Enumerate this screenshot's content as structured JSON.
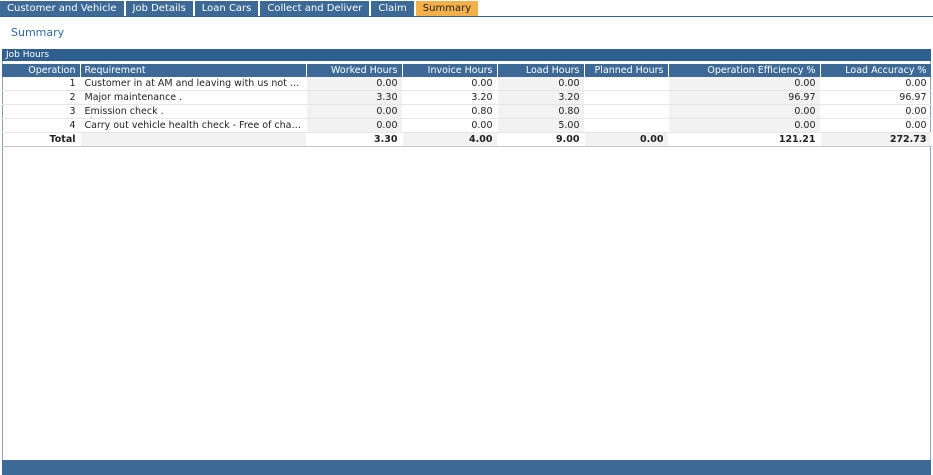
{
  "tabs": [
    {
      "label": "Customer and Vehicle"
    },
    {
      "label": "Job Details"
    },
    {
      "label": "Loan Cars"
    },
    {
      "label": "Collect and Deliver"
    },
    {
      "label": "Claim"
    },
    {
      "label": "Summary"
    }
  ],
  "active_tab": "Summary",
  "page_title": "Summary",
  "panel": {
    "title": "Job Hours"
  },
  "table": {
    "headers": [
      "Operation",
      "Requirement",
      "Worked Hours",
      "Invoice Hours",
      "Load Hours",
      "Planned Hours",
      "Operation Efficiency %",
      "Load Accuracy %"
    ],
    "rows": [
      [
        "1",
        "Customer in at AM and leaving with us not requir...",
        "0.00",
        "0.00",
        "0.00",
        "",
        "0.00",
        "0.00"
      ],
      [
        "2",
        "Major maintenance .",
        "3.30",
        "3.20",
        "3.20",
        "",
        "96.97",
        "96.97"
      ],
      [
        "3",
        "Emission check .",
        "0.00",
        "0.80",
        "0.80",
        "",
        "0.00",
        "0.00"
      ],
      [
        "4",
        "Carry out vehicle health check - Free of charge",
        "0.00",
        "0.00",
        "5.00",
        "",
        "0.00",
        "0.00"
      ]
    ],
    "total": [
      "Total",
      "",
      "3.30",
      "4.00",
      "9.00",
      "0.00",
      "121.21",
      "272.73"
    ]
  },
  "colors": {
    "tab_bg": "#3c6995",
    "tab_active_bg": "#f4b14a",
    "header_bg": "#2f5f8e",
    "title_color": "#2e6aa6"
  }
}
